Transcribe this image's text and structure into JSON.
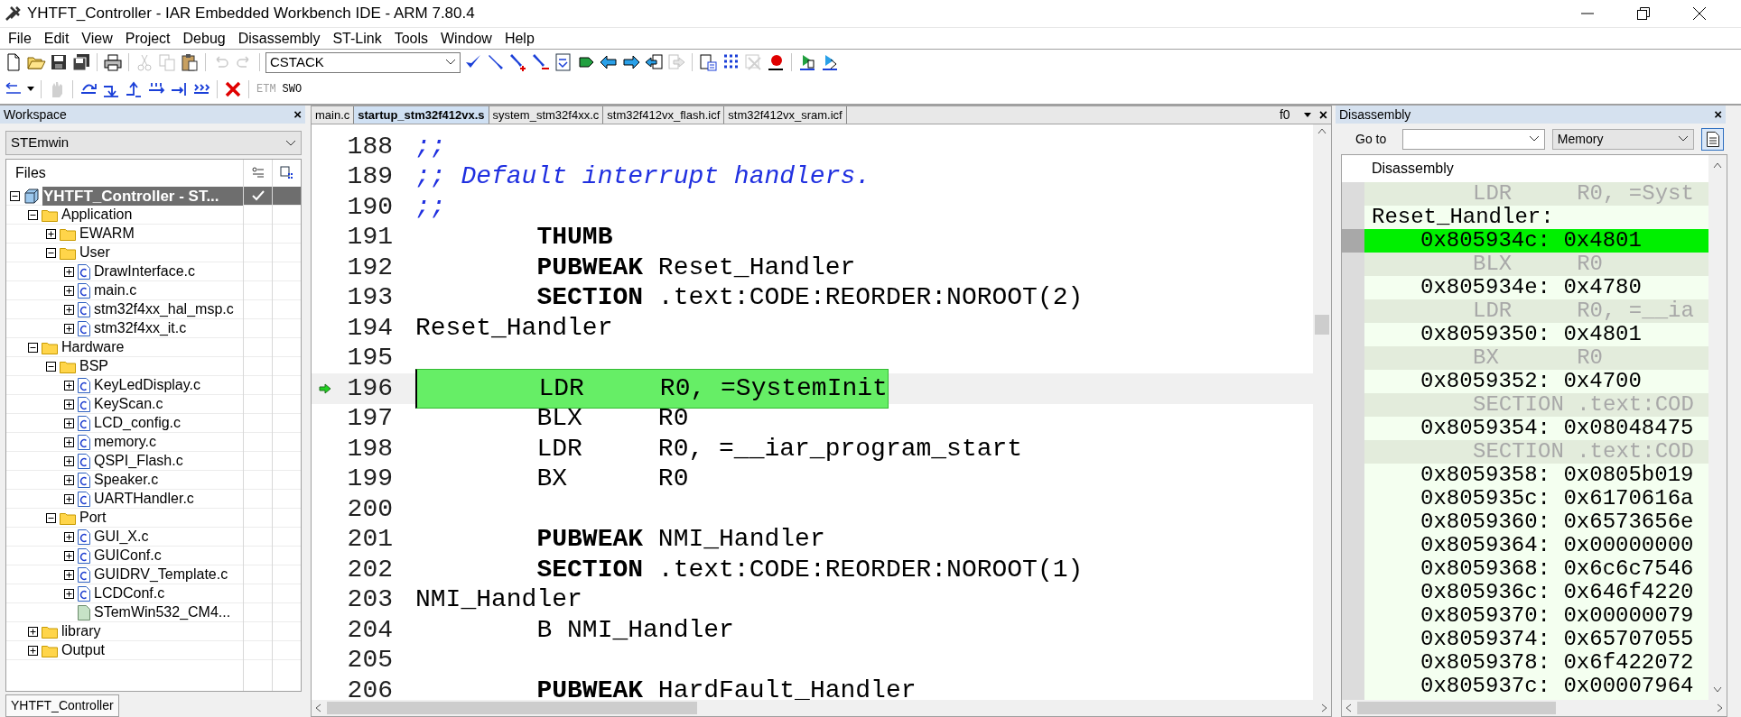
{
  "window": {
    "title": "YHTFT_Controller - IAR Embedded Workbench IDE - ARM 7.80.4"
  },
  "menu": [
    "File",
    "Edit",
    "View",
    "Project",
    "Debug",
    "Disassembly",
    "ST-Link",
    "Tools",
    "Window",
    "Help"
  ],
  "toolbar": {
    "stack_combo": "CSTACK",
    "trace_buttons": [
      {
        "label": "ETM",
        "disabled": true
      },
      {
        "label": "SWO",
        "disabled": false
      }
    ]
  },
  "workspace": {
    "title": "Workspace",
    "close": "×",
    "configuration": "STEmwin",
    "column": "Files",
    "bottom_tab": "YHTFT_Controller",
    "project": {
      "label": "YHTFT_Controller - ST...",
      "selected": true,
      "expanded": true,
      "checked": true,
      "children": [
        {
          "label": "Application",
          "kind": "folder",
          "expanded": true,
          "children": [
            {
              "label": "EWARM",
              "kind": "folder",
              "expanded": false
            },
            {
              "label": "User",
              "kind": "folder",
              "expanded": true,
              "children": [
                {
                  "label": "DrawInterface.c",
                  "kind": "file",
                  "expanded": false
                },
                {
                  "label": "main.c",
                  "kind": "file",
                  "expanded": false
                },
                {
                  "label": "stm32f4xx_hal_msp.c",
                  "kind": "file",
                  "expanded": false
                },
                {
                  "label": "stm32f4xx_it.c",
                  "kind": "file",
                  "expanded": false
                }
              ]
            }
          ]
        },
        {
          "label": "Hardware",
          "kind": "folder",
          "expanded": true,
          "children": [
            {
              "label": "BSP",
              "kind": "folder",
              "expanded": true,
              "children": [
                {
                  "label": "KeyLedDisplay.c",
                  "kind": "file",
                  "expanded": false
                },
                {
                  "label": "KeyScan.c",
                  "kind": "file",
                  "expanded": false
                },
                {
                  "label": "LCD_config.c",
                  "kind": "file",
                  "expanded": false
                },
                {
                  "label": "memory.c",
                  "kind": "file",
                  "expanded": false
                },
                {
                  "label": "QSPI_Flash.c",
                  "kind": "file",
                  "expanded": false
                },
                {
                  "label": "Speaker.c",
                  "kind": "file",
                  "expanded": false
                },
                {
                  "label": "UARTHandler.c",
                  "kind": "file",
                  "expanded": false
                }
              ]
            },
            {
              "label": "Port",
              "kind": "folder",
              "expanded": true,
              "children": [
                {
                  "label": "GUI_X.c",
                  "kind": "file",
                  "expanded": false
                },
                {
                  "label": "GUIConf.c",
                  "kind": "file",
                  "expanded": false
                },
                {
                  "label": "GUIDRV_Template.c",
                  "kind": "file",
                  "expanded": false
                },
                {
                  "label": "LCDConf.c",
                  "kind": "file",
                  "expanded": false
                },
                {
                  "label": "STemWin532_CM4...",
                  "kind": "library"
                }
              ]
            }
          ]
        },
        {
          "label": "library",
          "kind": "folder",
          "expanded": false
        },
        {
          "label": "Output",
          "kind": "folder",
          "expanded": false
        }
      ]
    }
  },
  "editor": {
    "tabs": [
      {
        "label": "main.c",
        "selected": false
      },
      {
        "label": "startup_stm32f412vx.s",
        "selected": true
      },
      {
        "label": "system_stm32f4xx.c",
        "selected": false
      },
      {
        "label": "stm32f412vx_flash.icf",
        "selected": false
      },
      {
        "label": "stm32f412vx_sram.icf",
        "selected": false
      }
    ],
    "function_box": "f0",
    "close": "×",
    "lines": [
      {
        "number": "188",
        "indented": false,
        "current": false,
        "tokens": [
          {
            "kind": "comment",
            "text": ";;"
          }
        ]
      },
      {
        "number": "189",
        "indented": false,
        "current": false,
        "tokens": [
          {
            "kind": "comment",
            "text": ";; Default interrupt handlers."
          }
        ]
      },
      {
        "number": "190",
        "indented": false,
        "current": false,
        "tokens": [
          {
            "kind": "comment",
            "text": ";;"
          }
        ]
      },
      {
        "number": "191",
        "indented": true,
        "current": false,
        "tokens": [
          {
            "kind": "keyword",
            "text": "THUMB"
          }
        ]
      },
      {
        "number": "192",
        "indented": true,
        "current": false,
        "tokens": [
          {
            "kind": "keyword",
            "text": "PUBWEAK"
          },
          {
            "kind": "plain",
            "text": " Reset_Handler"
          }
        ]
      },
      {
        "number": "193",
        "indented": true,
        "current": false,
        "tokens": [
          {
            "kind": "keyword",
            "text": "SECTION"
          },
          {
            "kind": "plain",
            "text": " .text:CODE:REORDER:NOROOT(2)"
          }
        ]
      },
      {
        "number": "194",
        "indented": false,
        "current": false,
        "tokens": [
          {
            "kind": "plain",
            "text": "Reset_Handler"
          }
        ]
      },
      {
        "number": "195"
      },
      {
        "number": "196",
        "indented": true,
        "current": true,
        "tokens": [
          {
            "kind": "plain",
            "text": "LDR     R0, =SystemInit"
          }
        ]
      },
      {
        "number": "197",
        "indented": true,
        "current": false,
        "tokens": [
          {
            "kind": "plain",
            "text": "BLX     R0"
          }
        ]
      },
      {
        "number": "198",
        "indented": true,
        "current": false,
        "tokens": [
          {
            "kind": "plain",
            "text": "LDR     R0, =__iar_program_start"
          }
        ]
      },
      {
        "number": "199",
        "indented": true,
        "current": false,
        "tokens": [
          {
            "kind": "plain",
            "text": "BX      R0"
          }
        ]
      },
      {
        "number": "200"
      },
      {
        "number": "201",
        "indented": true,
        "current": false,
        "tokens": [
          {
            "kind": "keyword",
            "text": "PUBWEAK"
          },
          {
            "kind": "plain",
            "text": " NMI_Handler"
          }
        ]
      },
      {
        "number": "202",
        "indented": true,
        "current": false,
        "tokens": [
          {
            "kind": "keyword",
            "text": "SECTION"
          },
          {
            "kind": "plain",
            "text": " .text:CODE:REORDER:NOROOT(1)"
          }
        ]
      },
      {
        "number": "203",
        "indented": false,
        "current": false,
        "tokens": [
          {
            "kind": "plain",
            "text": "NMI_Handler"
          }
        ]
      },
      {
        "number": "204",
        "indented": true,
        "current": false,
        "tokens": [
          {
            "kind": "plain",
            "text": "B NMI_Handler"
          }
        ]
      },
      {
        "number": "205"
      },
      {
        "number": "206",
        "indented": true,
        "current": false,
        "tokens": [
          {
            "kind": "keyword",
            "text": "PUBWEAK"
          },
          {
            "kind": "plain",
            "text": " HardFault_Handler"
          }
        ]
      }
    ]
  },
  "disassembly": {
    "title": "Disassembly",
    "close": "×",
    "goto_label": "Go to",
    "memory_combo": "Memory",
    "column": "Disassembly",
    "rows": [
      {
        "kind": "source",
        "text": "LDR     R0, =Syst"
      },
      {
        "kind": "label",
        "text": "Reset_Handler:"
      },
      {
        "kind": "code",
        "text": "0x805934c: 0x4801",
        "current": true
      },
      {
        "kind": "source",
        "text": "BLX     R0"
      },
      {
        "kind": "code",
        "text": "0x805934e: 0x4780",
        "current": false
      },
      {
        "kind": "source",
        "text": "LDR     R0, =__ia"
      },
      {
        "kind": "code",
        "text": "0x8059350: 0x4801",
        "current": false
      },
      {
        "kind": "source",
        "text": "BX      R0"
      },
      {
        "kind": "code",
        "text": "0x8059352: 0x4700",
        "current": false
      },
      {
        "kind": "source",
        "text": "SECTION .text:COD"
      },
      {
        "kind": "code",
        "text": "0x8059354: 0x08048475",
        "current": false
      },
      {
        "kind": "source",
        "text": "SECTION .text:COD"
      },
      {
        "kind": "code",
        "text": "0x8059358: 0x0805b019",
        "current": false
      },
      {
        "kind": "code",
        "text": "0x805935c: 0x6170616a",
        "current": false
      },
      {
        "kind": "code",
        "text": "0x8059360: 0x6573656e",
        "current": false
      },
      {
        "kind": "code",
        "text": "0x8059364: 0x00000000",
        "current": false
      },
      {
        "kind": "code",
        "text": "0x8059368: 0x6c6c7546",
        "current": false
      },
      {
        "kind": "code",
        "text": "0x805936c: 0x646f4220",
        "current": false
      },
      {
        "kind": "code",
        "text": "0x8059370: 0x00000079",
        "current": false
      },
      {
        "kind": "code",
        "text": "0x8059374: 0x65707055",
        "current": false
      },
      {
        "kind": "code",
        "text": "0x8059378: 0x6f422072",
        "current": false
      },
      {
        "kind": "code",
        "text": "0x805937c: 0x00007964",
        "current": false
      }
    ]
  }
}
